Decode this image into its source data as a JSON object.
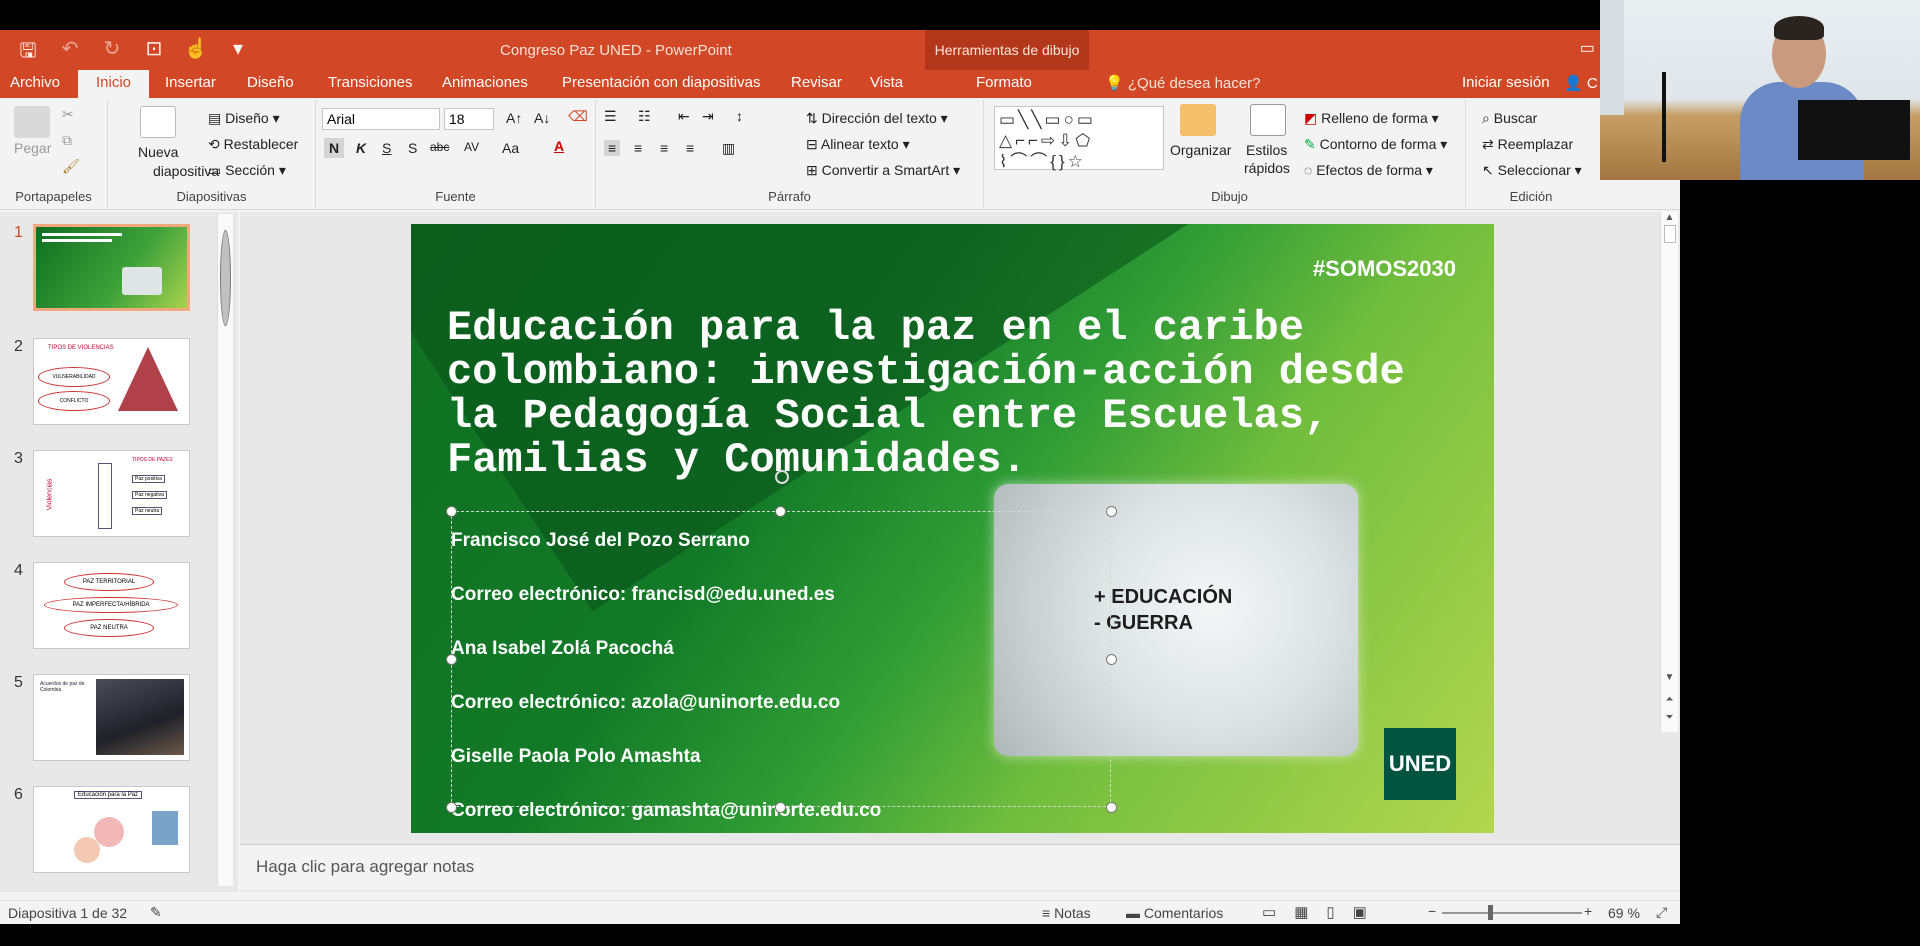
{
  "app": {
    "title": "Congreso Paz UNED - PowerPoint",
    "contextual_tools": "Herramientas de dibujo"
  },
  "tabs": {
    "items": [
      "Archivo",
      "Inicio",
      "Insertar",
      "Diseño",
      "Transiciones",
      "Animaciones",
      "Presentación con diapositivas",
      "Revisar",
      "Vista"
    ],
    "active": "Inicio",
    "format": "Formato",
    "tell_me": "¿Qué desea hacer?",
    "sign_in": "Iniciar sesión",
    "share_partial": "C"
  },
  "ribbon": {
    "clipboard": {
      "label": "Portapapeles",
      "paste": "Pegar"
    },
    "slides": {
      "label": "Diapositivas",
      "new_slide_1": "Nueva",
      "new_slide_2": "diapositiva",
      "layout": "Diseño",
      "reset": "Restablecer",
      "section": "Sección"
    },
    "font": {
      "label": "Fuente",
      "family": "Arial",
      "size": "18",
      "bold": "N",
      "italic": "K",
      "underline": "S",
      "shadow": "S",
      "strike": "abc",
      "spacing": "AV",
      "case": "Aa"
    },
    "paragraph": {
      "label": "Párrafo",
      "text_direction": "Dirección del texto",
      "align_text": "Alinear texto",
      "smartart": "Convertir a SmartArt"
    },
    "drawing": {
      "label": "Dibujo",
      "arrange": "Organizar",
      "quick_styles_1": "Estilos",
      "quick_styles_2": "rápidos",
      "fill": "Relleno de forma",
      "outline": "Contorno de forma",
      "effects": "Efectos de forma"
    },
    "editing": {
      "label": "Edición",
      "find": "Buscar",
      "replace": "Reemplazar",
      "select": "Seleccionar"
    }
  },
  "thumbnails": {
    "numbers": [
      "1",
      "2",
      "3",
      "4",
      "5",
      "6"
    ],
    "t2": {
      "a": "TIPOS DE VIOLENCIAS",
      "b": "VULNERABILIDAD",
      "c": "CONFLICTO"
    },
    "t3": {
      "a": "Violencias",
      "b": "Paz",
      "c": "TIPOS DE PAZES",
      "d": "Paz positiva",
      "e": "Paz negativa",
      "f": "Paz neutra"
    },
    "t4": {
      "a": "PAZ TERRITORIAL",
      "b": "PAZ IMPERFECTA/HÍBRIDA",
      "c": "PAZ NEUTRA"
    },
    "t5": {
      "a": "Acuerdos de paz de Colombia"
    },
    "t6": {
      "a": "Educación para la Paz"
    }
  },
  "slide": {
    "hashtag": "#SOMOS2030",
    "title": "Educación para la paz en el caribe colombiano: investigación-acción desde la Pedagogía Social entre Escuelas, Familias y Comunidades.",
    "authors": [
      "Francisco José del Pozo Serrano",
      "Correo electrónico: francisd@edu.uned.es",
      "Ana Isabel Zolá Pacochá",
      "Correo electrónico: azola@uninorte.edu.co",
      "Giselle Paola Polo Amashta",
      "Correo electrónico: gamashta@uninorte.edu.co"
    ],
    "photo_text_1": "+ EDUCACIÓN",
    "photo_text_2": "- GUERRA",
    "logo": "UNED"
  },
  "notes_placeholder": "Haga clic para agregar notas",
  "status": {
    "slide_counter": "Diapositiva 1 de 32",
    "notes": "Notas",
    "comments": "Comentarios",
    "zoom": "69 %"
  },
  "colors": {
    "accent": "#d24726",
    "slide_green": "#127a27",
    "uned_green": "#00533e"
  },
  "icons": [
    "save-icon",
    "undo-icon",
    "redo-icon",
    "presenter-icon",
    "touch-icon",
    "search-icon",
    "user-icon"
  ]
}
